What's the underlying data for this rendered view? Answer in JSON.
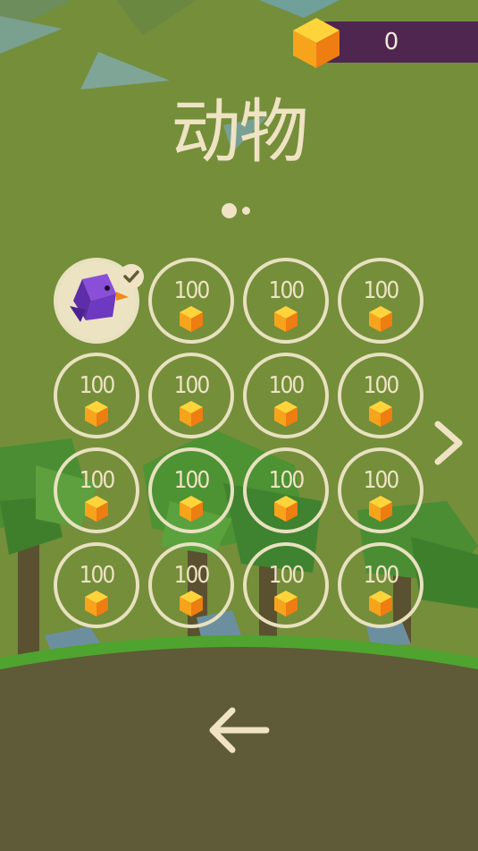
{
  "header": {
    "coin_count": "0",
    "coin_icon": "gem-cube-icon"
  },
  "title": "动物",
  "pager": {
    "pages": 2,
    "current": 1
  },
  "grid": {
    "selected": {
      "icon": "purple-bird-icon",
      "status": "check-icon"
    },
    "items": [
      {
        "price": "100"
      },
      {
        "price": "100"
      },
      {
        "price": "100"
      },
      {
        "price": "100"
      },
      {
        "price": "100"
      },
      {
        "price": "100"
      },
      {
        "price": "100"
      },
      {
        "price": "100"
      },
      {
        "price": "100"
      },
      {
        "price": "100"
      },
      {
        "price": "100"
      },
      {
        "price": "100"
      },
      {
        "price": "100"
      },
      {
        "price": "100"
      },
      {
        "price": "100"
      }
    ]
  },
  "nav": {
    "next_icon": "chevron-right-icon",
    "back_icon": "arrow-left-icon"
  },
  "colors": {
    "background": "#748e3a",
    "ground": "#5f5a37",
    "accent": "#efe3c4",
    "coin_bar": "#4e2650",
    "cube_orange": "#f5a321"
  }
}
